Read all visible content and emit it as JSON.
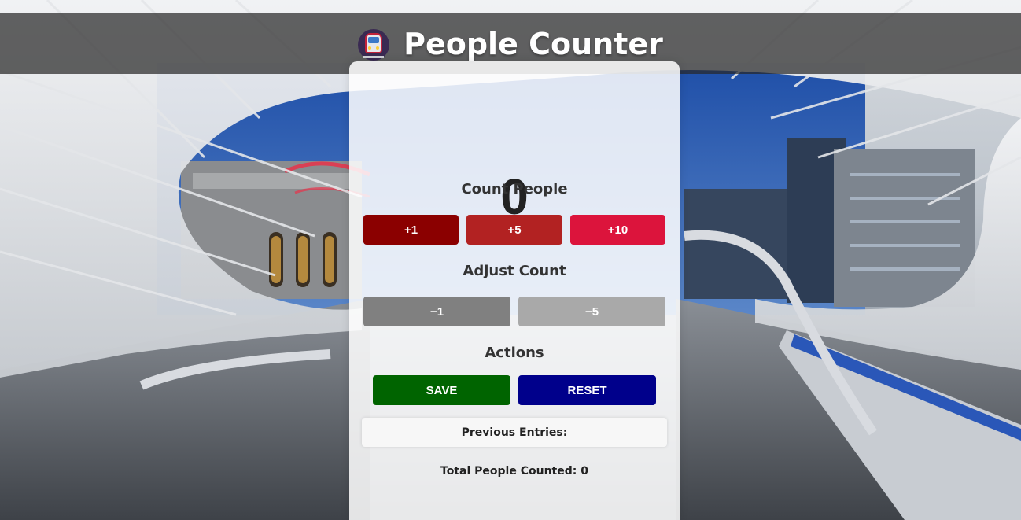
{
  "header": {
    "icon": "train-icon",
    "title": "People Counter"
  },
  "counter": {
    "value": "0"
  },
  "sections": {
    "count_label": "Count People",
    "adjust_label": "Adjust Count",
    "actions_label": "Actions"
  },
  "count_buttons": [
    {
      "label": "+1",
      "color": "#8b0000"
    },
    {
      "label": "+5",
      "color": "#b22222"
    },
    {
      "label": "+10",
      "color": "#dc143c"
    }
  ],
  "adjust_buttons": [
    {
      "label": "−1",
      "color": "#808080"
    },
    {
      "label": "−5",
      "color": "#a9a9a9"
    }
  ],
  "action_buttons": {
    "save_label": "SAVE",
    "save_color": "#006400",
    "reset_label": "RESET",
    "reset_color": "#00008b"
  },
  "entries": {
    "label": "Previous Entries:"
  },
  "total": {
    "label": "Total People Counted: 0"
  }
}
